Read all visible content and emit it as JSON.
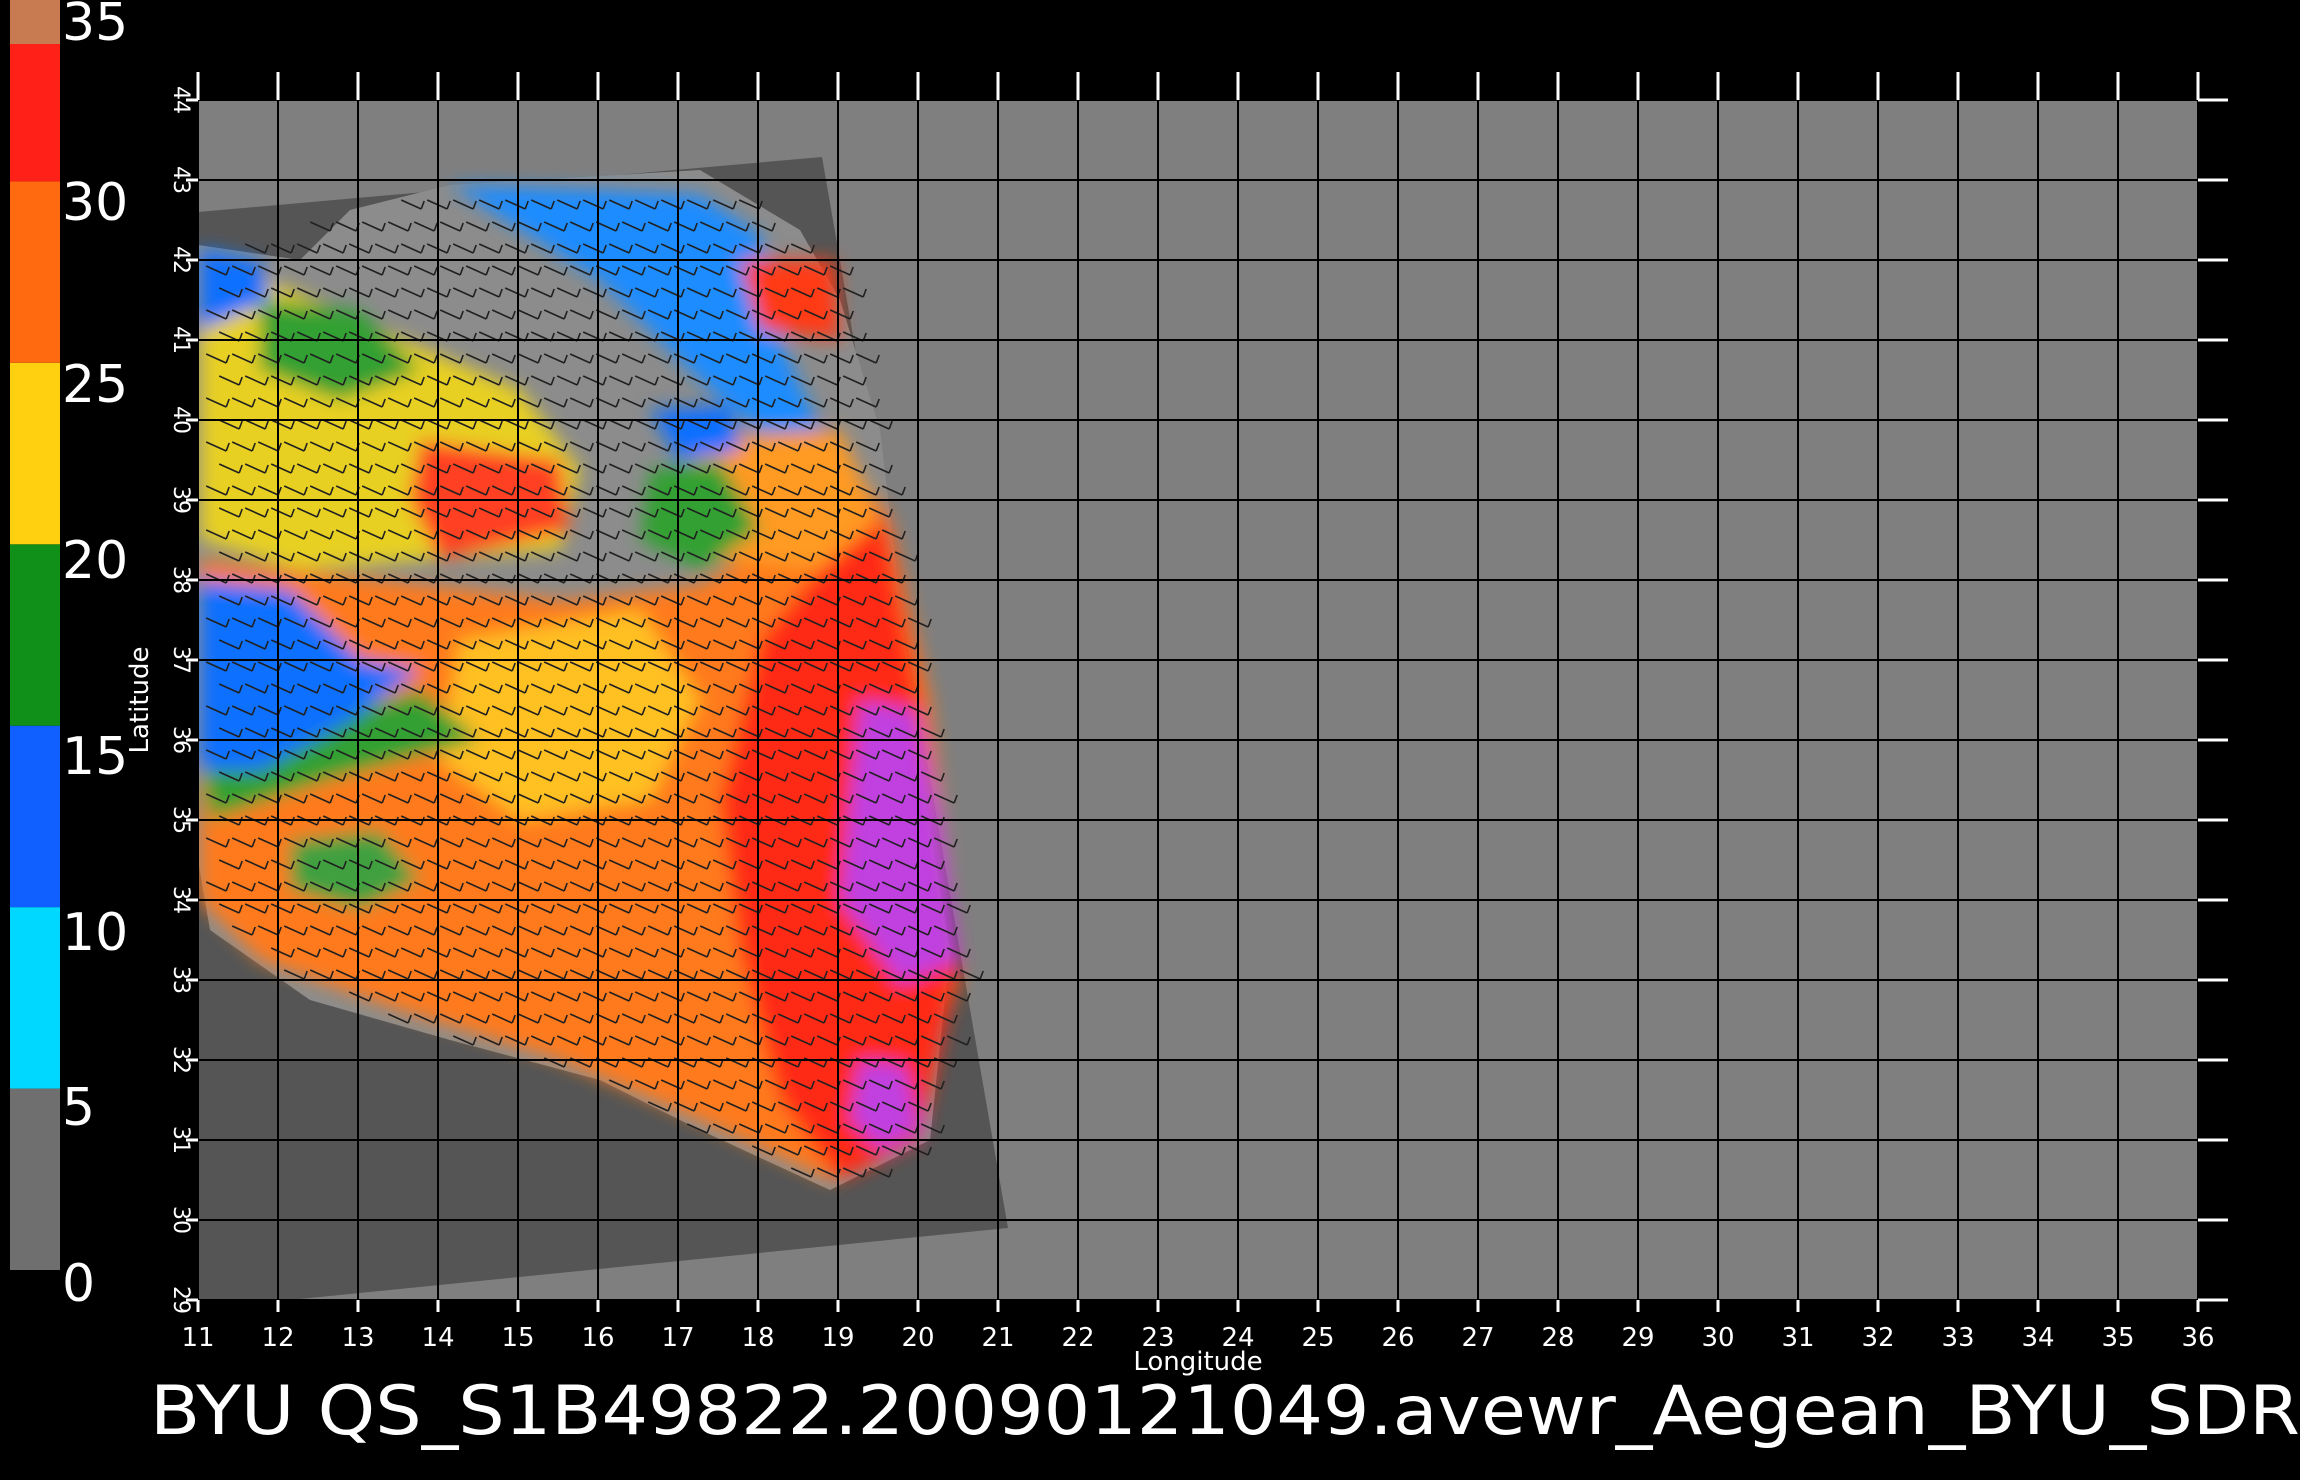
{
  "colorbar": {
    "ticks": [
      "0",
      "5",
      "10",
      "15",
      "20",
      "25",
      "30",
      "35"
    ],
    "segments": [
      {
        "from": 0,
        "to": 5,
        "color": "#6f6f6f"
      },
      {
        "from": 5,
        "to": 10,
        "color": "#00d8ff"
      },
      {
        "from": 10,
        "to": 15,
        "color": "#1060ff"
      },
      {
        "from": 15,
        "to": 20,
        "color": "#109018"
      },
      {
        "from": 20,
        "to": 25,
        "color": "#ffd010"
      },
      {
        "from": 25,
        "to": 30,
        "color": "#ff6a10"
      },
      {
        "from": 30,
        "to": 35,
        "color": "#ff2018"
      }
    ],
    "cap_color": "#c87a50"
  },
  "map": {
    "x_axis": {
      "label": "Longitude",
      "range": [
        11,
        36
      ],
      "ticks": [
        "11",
        "12",
        "13",
        "14",
        "15",
        "16",
        "17",
        "18",
        "19",
        "20",
        "21",
        "22",
        "23",
        "24",
        "25",
        "26",
        "27",
        "28",
        "29",
        "30",
        "31",
        "32",
        "33",
        "34",
        "35",
        "36"
      ]
    },
    "y_axis": {
      "label": "Latitude",
      "range": [
        29,
        44
      ],
      "ticks": [
        "29",
        "30",
        "31",
        "32",
        "33",
        "34",
        "35",
        "36",
        "37",
        "38",
        "39",
        "40",
        "41",
        "42",
        "43",
        "44"
      ]
    },
    "grid": true,
    "background_color": "#7f7f7f",
    "swath_color": "#555555"
  },
  "caption": "BYU  QS_S1B49822.20090121049.avewr_Aegean_BYU_SDR"
}
